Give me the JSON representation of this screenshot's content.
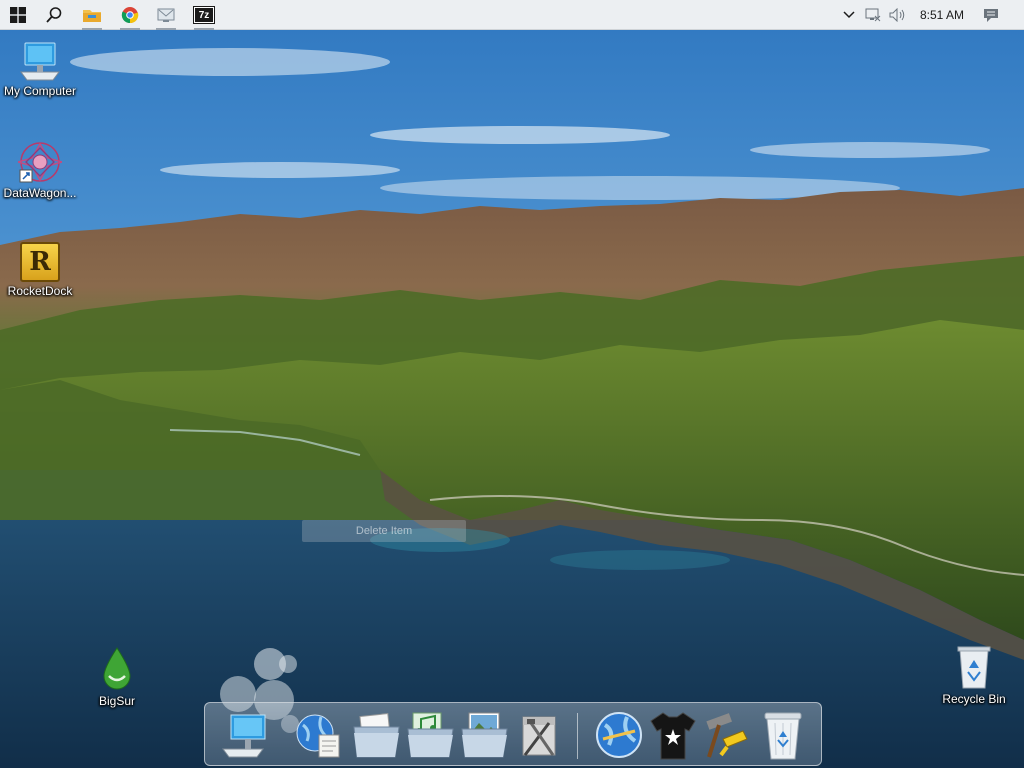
{
  "taskbar": {
    "start_button": "start-icon",
    "search_button": "search-icon",
    "pinned": [
      {
        "name": "file-explorer",
        "icon": "folder-icon"
      },
      {
        "name": "chrome",
        "icon": "chrome-icon"
      },
      {
        "name": "network-app",
        "icon": "monitor-mail-icon"
      },
      {
        "name": "7zip",
        "icon": "7zip-icon",
        "label": "7z"
      }
    ],
    "tray": {
      "chevron": "chevron-up-icon",
      "network": "network-icon",
      "volume": "volume-icon",
      "clock": "8:51 AM",
      "notifications": "notification-icon"
    }
  },
  "desktop": {
    "icons": [
      {
        "label": "My Computer",
        "icon": "computer-icon"
      },
      {
        "label": "DataWagon...",
        "icon": "datawagon-icon"
      },
      {
        "label": "RocketDock",
        "icon": "rocketdock-icon",
        "letter": "R"
      },
      {
        "label": "BigSur",
        "icon": "droplet-icon"
      },
      {
        "label": "Recycle Bin",
        "icon": "recycle-bin-icon"
      }
    ],
    "ghost_tooltip": "Delete Item"
  },
  "dock": {
    "items": [
      {
        "name": "computer",
        "icon": "computer-icon"
      },
      {
        "name": "globe-documents",
        "icon": "globe-doc-icon"
      },
      {
        "name": "documents-folder",
        "icon": "documents-folder-icon"
      },
      {
        "name": "music-folder",
        "icon": "music-folder-icon"
      },
      {
        "name": "pictures-folder",
        "icon": "pictures-folder-icon"
      },
      {
        "name": "system-tools",
        "icon": "tools-icon"
      },
      {
        "name": "internet",
        "icon": "globe-icon"
      },
      {
        "name": "theme-shirt",
        "icon": "tshirt-icon"
      },
      {
        "name": "settings-tools",
        "icon": "hammer-wrench-icon"
      },
      {
        "name": "trash",
        "icon": "trash-icon"
      }
    ]
  },
  "colors": {
    "taskbar_bg": "#eceff2",
    "sky": "#4a8fcf",
    "water": "#1b4a6e",
    "mountains": "#4f6a2c"
  }
}
